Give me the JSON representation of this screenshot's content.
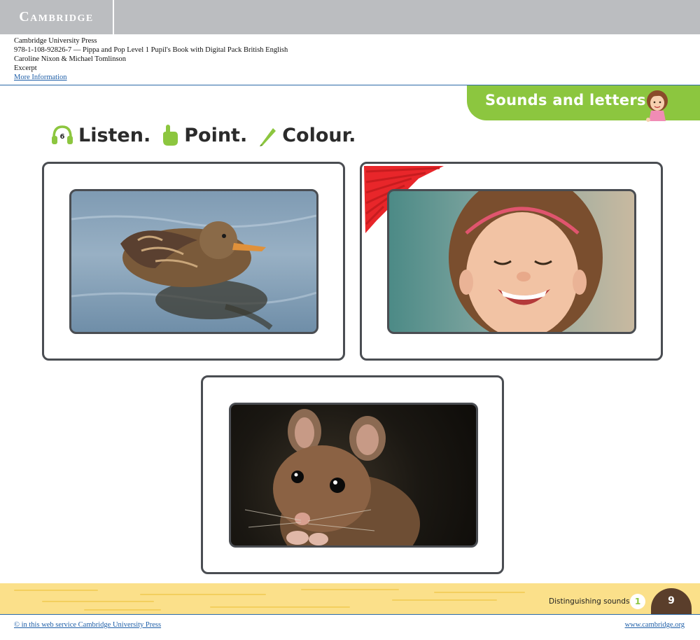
{
  "header": {
    "logo_text": "Cambridge",
    "logo_color": "#ffffff",
    "bar_color": "#bbbdc0"
  },
  "meta": {
    "publisher": "Cambridge University Press",
    "isbn_title": "978-1-108-92826-7 — Pippa and Pop Level 1 Pupil's Book with Digital Pack British English",
    "authors": "Caroline Nixon & Michael Tomlinson",
    "excerpt_label": "Excerpt",
    "more_info_link": "More Information"
  },
  "section_tab": {
    "label": "Sounds and letters",
    "color": "#8cc63f",
    "icon": "girl-character-icon"
  },
  "instruction": {
    "track_number": "6",
    "listen": "Listen.",
    "point": "Point.",
    "colour": "Colour.",
    "icons": [
      "headphones-icon",
      "pointing-hand-icon",
      "pencil-icon"
    ],
    "accent": "#8cc63f"
  },
  "cards": [
    {
      "subject": "duck",
      "coloured_corner": false
    },
    {
      "subject": "girl laughing",
      "coloured_corner": true,
      "scribble_color": "#e8262a"
    },
    {
      "subject": "mouse",
      "coloured_corner": false
    }
  ],
  "footer_strip": {
    "label": "Distinguishing sounds",
    "unit_number": "1",
    "page_number": "9",
    "strip_color": "#fbe08a"
  },
  "footer": {
    "copyright": "© in this web service Cambridge University Press",
    "site": "www.cambridge.org"
  }
}
